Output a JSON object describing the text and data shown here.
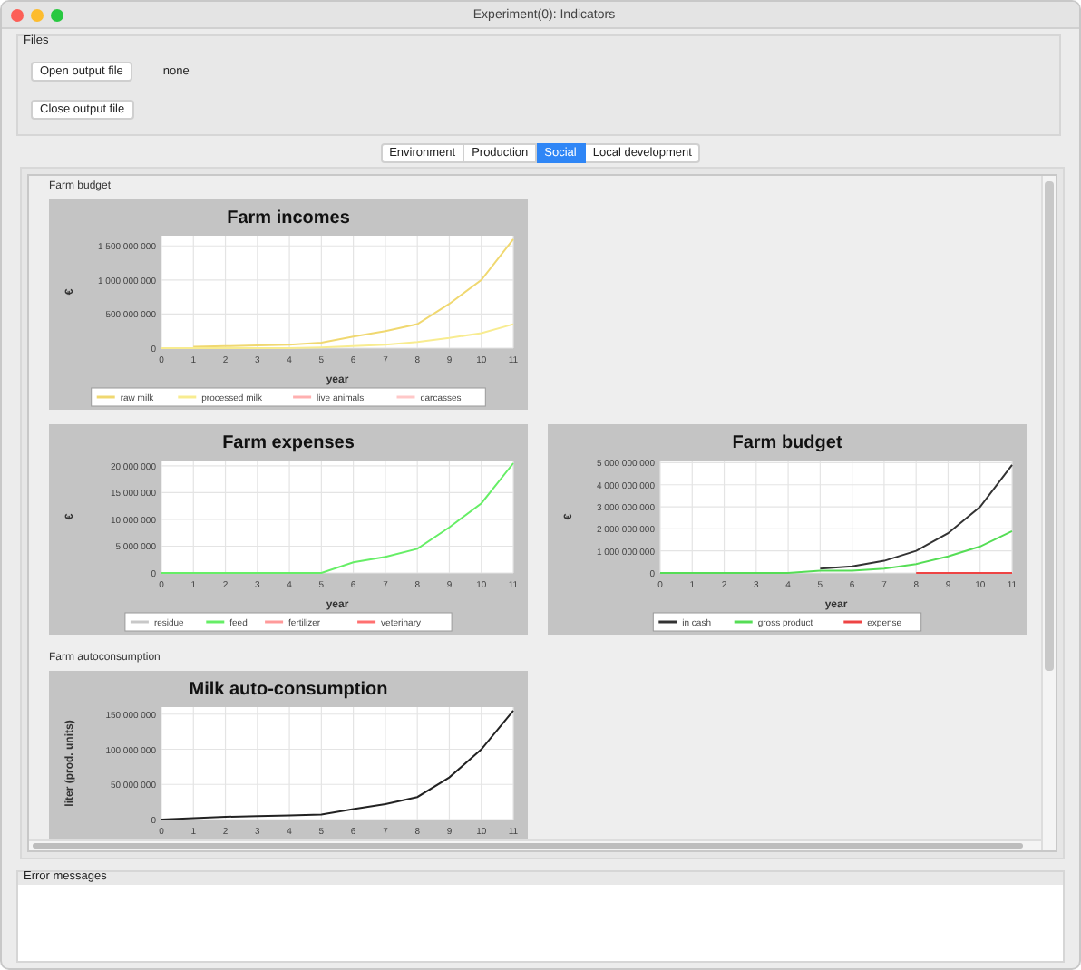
{
  "window": {
    "title": "Experiment(0): Indicators"
  },
  "files": {
    "title": "Files",
    "open_button": "Open output file",
    "file_name": "none",
    "close_button": "Close output file"
  },
  "tabs": [
    {
      "label": "Environment",
      "selected": false
    },
    {
      "label": "Production",
      "selected": false
    },
    {
      "label": "Social",
      "selected": true
    },
    {
      "label": "Local development",
      "selected": false
    }
  ],
  "sections": [
    {
      "title": "Farm budget",
      "rows": [
        [
          {
            "chart_data": {
              "type": "line",
              "title": "Farm incomes",
              "xlabel": "year",
              "ylabel": "€",
              "x": [
                0,
                1,
                2,
                3,
                4,
                5,
                6,
                7,
                8,
                9,
                10,
                11
              ],
              "xlim": [
                0,
                11
              ],
              "ylim": [
                0,
                1650000000
              ],
              "grid": true,
              "legend": "bottom",
              "xticks": [
                0,
                1,
                2,
                3,
                4,
                5,
                6,
                7,
                8,
                9,
                10,
                11
              ],
              "yticks": [
                {
                  "value": 0,
                  "label": "0"
                },
                {
                  "value": 500000000,
                  "label": "500 000 000"
                },
                {
                  "value": 1000000000,
                  "label": "1 000 000 000"
                },
                {
                  "value": 1500000000,
                  "label": "1 500 000 000"
                }
              ],
              "series": [
                {
                  "name": "raw milk",
                  "color": "#f0d870",
                  "values": [
                    null,
                    20000000,
                    30000000,
                    40000000,
                    50000000,
                    80000000,
                    170000000,
                    250000000,
                    350000000,
                    650000000,
                    1000000000,
                    1600000000
                  ]
                },
                {
                  "name": "processed milk",
                  "color": "#f8ec90",
                  "values": [
                    0,
                    0,
                    0,
                    0,
                    0,
                    10000000,
                    30000000,
                    50000000,
                    90000000,
                    150000000,
                    220000000,
                    350000000
                  ]
                },
                {
                  "name": "live animals",
                  "color": "#ffb0b0",
                  "values": [
                    null,
                    null,
                    null,
                    null,
                    null,
                    null,
                    null,
                    null,
                    null,
                    null,
                    null,
                    null
                  ]
                },
                {
                  "name": "carcasses",
                  "color": "#ffc8c8",
                  "values": [
                    null,
                    null,
                    null,
                    null,
                    null,
                    null,
                    null,
                    null,
                    null,
                    null,
                    null,
                    null
                  ]
                }
              ]
            }
          }
        ],
        [
          {
            "chart_data": {
              "type": "line",
              "title": "Farm expenses",
              "xlabel": "year",
              "ylabel": "€",
              "x": [
                0,
                1,
                2,
                3,
                4,
                5,
                6,
                7,
                8,
                9,
                10,
                11
              ],
              "xlim": [
                0,
                11
              ],
              "ylim": [
                0,
                21000000
              ],
              "grid": true,
              "legend": "bottom",
              "xticks": [
                0,
                1,
                2,
                3,
                4,
                5,
                6,
                7,
                8,
                9,
                10,
                11
              ],
              "yticks": [
                {
                  "value": 0,
                  "label": "0"
                },
                {
                  "value": 5000000,
                  "label": "5 000 000"
                },
                {
                  "value": 10000000,
                  "label": "10 000 000"
                },
                {
                  "value": 15000000,
                  "label": "15 000 000"
                },
                {
                  "value": 20000000,
                  "label": "20 000 000"
                }
              ],
              "series": [
                {
                  "name": "residue",
                  "color": "#c8c8c8",
                  "values": [
                    null,
                    null,
                    null,
                    null,
                    null,
                    null,
                    null,
                    null,
                    null,
                    null,
                    null,
                    null
                  ]
                },
                {
                  "name": "feed",
                  "color": "#66ee66",
                  "values": [
                    0,
                    0,
                    0,
                    0,
                    0,
                    0,
                    2000000,
                    3000000,
                    4500000,
                    8500000,
                    13000000,
                    20500000
                  ]
                },
                {
                  "name": "fertilizer",
                  "color": "#ff9a9a",
                  "values": [
                    null,
                    null,
                    null,
                    null,
                    null,
                    null,
                    null,
                    null,
                    null,
                    null,
                    null,
                    null
                  ]
                },
                {
                  "name": "veterinary",
                  "color": "#ff7070",
                  "values": [
                    null,
                    null,
                    null,
                    null,
                    null,
                    null,
                    null,
                    null,
                    null,
                    null,
                    null,
                    null
                  ]
                }
              ]
            }
          },
          {
            "chart_data": {
              "type": "line",
              "title": "Farm budget",
              "xlabel": "year",
              "ylabel": "€",
              "x": [
                0,
                1,
                2,
                3,
                4,
                5,
                6,
                7,
                8,
                9,
                10,
                11
              ],
              "xlim": [
                0,
                11
              ],
              "ylim": [
                0,
                5100000000
              ],
              "grid": true,
              "legend": "bottom",
              "xticks": [
                0,
                1,
                2,
                3,
                4,
                5,
                6,
                7,
                8,
                9,
                10,
                11
              ],
              "yticks": [
                {
                  "value": 0,
                  "label": "0"
                },
                {
                  "value": 1000000000,
                  "label": "1 000 000 000"
                },
                {
                  "value": 2000000000,
                  "label": "2 000 000 000"
                },
                {
                  "value": 3000000000,
                  "label": "3 000 000 000"
                },
                {
                  "value": 4000000000,
                  "label": "4 000 000 000"
                },
                {
                  "value": 5000000000,
                  "label": "5 000 000 000"
                }
              ],
              "series": [
                {
                  "name": "in cash",
                  "color": "#333333",
                  "values": [
                    null,
                    null,
                    null,
                    null,
                    null,
                    200000000,
                    300000000,
                    550000000,
                    1000000000,
                    1800000000,
                    3000000000,
                    4900000000
                  ]
                },
                {
                  "name": "gross product",
                  "color": "#55dd55",
                  "values": [
                    0,
                    0,
                    0,
                    0,
                    0,
                    100000000,
                    100000000,
                    200000000,
                    400000000,
                    750000000,
                    1200000000,
                    1900000000
                  ]
                },
                {
                  "name": "expense",
                  "color": "#ee4444",
                  "values": [
                    null,
                    null,
                    null,
                    null,
                    null,
                    null,
                    null,
                    null,
                    0,
                    0,
                    0,
                    0
                  ]
                }
              ]
            }
          }
        ]
      ]
    },
    {
      "title": "Farm autoconsumption",
      "rows": [
        [
          {
            "chart_data": {
              "type": "line",
              "title": "Milk auto-consumption",
              "ylabel": "liter (prod. units)",
              "x": [
                0,
                1,
                2,
                3,
                4,
                5,
                6,
                7,
                8,
                9,
                10,
                11
              ],
              "xlim": [
                0,
                11
              ],
              "ylim": [
                0,
                160000000
              ],
              "grid": true,
              "xticks": [
                0,
                1,
                2,
                3,
                4,
                5,
                6,
                7,
                8,
                9,
                10,
                11
              ],
              "yticks": [
                {
                  "value": 0,
                  "label": "0"
                },
                {
                  "value": 50000000,
                  "label": "50 000 000"
                },
                {
                  "value": 100000000,
                  "label": "100 000 000"
                },
                {
                  "value": 150000000,
                  "label": "150 000 000"
                }
              ],
              "series": [
                {
                  "color": "#222222",
                  "values": [
                    0,
                    2000000,
                    4000000,
                    5000000,
                    6000000,
                    7000000,
                    15000000,
                    22000000,
                    32000000,
                    60000000,
                    100000000,
                    155000000
                  ]
                }
              ]
            }
          }
        ]
      ]
    }
  ],
  "error_panel": {
    "title": "Error messages"
  }
}
